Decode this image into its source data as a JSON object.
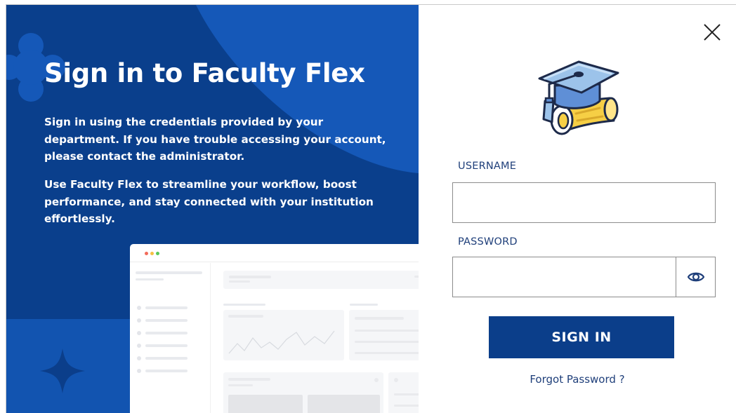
{
  "left": {
    "title": "Sign in to Faculty Flex",
    "paragraph1": "Sign in using the credentials provided by your department. If you have trouble accessing your account, please contact the administrator.",
    "paragraph2": "Use Faculty Flex to streamline your workflow, boost performance, and stay connected with your institution effortlessly."
  },
  "form": {
    "username_label": "USERNAME",
    "username_value": "",
    "password_label": "PASSWORD",
    "password_value": "",
    "sign_in_label": "SIGN IN",
    "forgot_label": "Forgot Password ?"
  },
  "icons": {
    "close": "close-icon",
    "eye": "eye-icon",
    "logo": "graduation-cap-diploma-icon",
    "sparkle": "sparkle-icon"
  },
  "colors": {
    "panel_blue": "#0a3f8c",
    "accent_blue": "#1558b8",
    "button_blue": "#0b3e8a",
    "label_blue": "#1f3f7a",
    "cap_blue": "#9cc3ea",
    "diploma_yellow": "#f6cf45"
  }
}
